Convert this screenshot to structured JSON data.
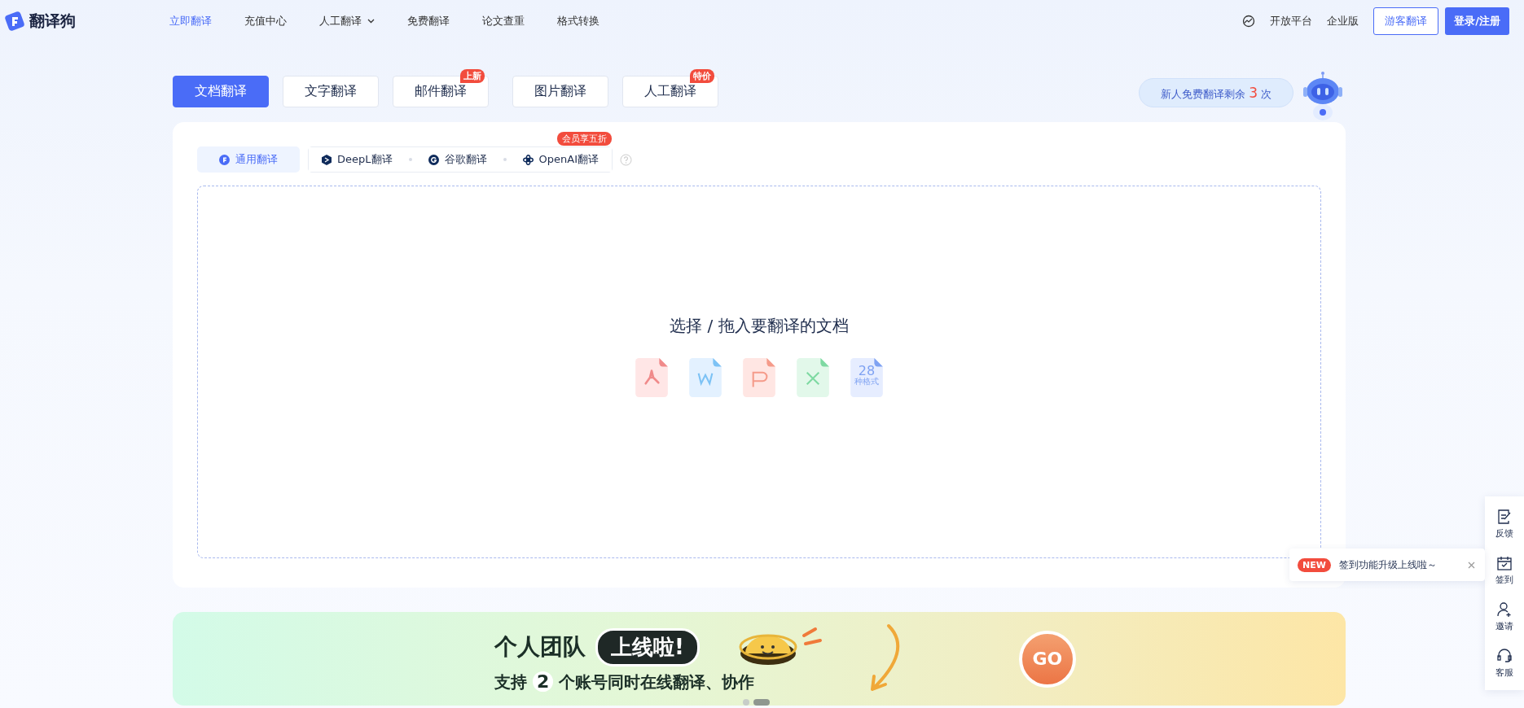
{
  "logo": {
    "text": "翻译狗"
  },
  "nav": {
    "items": [
      {
        "label": "立即翻译",
        "selected": true,
        "kind": "link"
      },
      {
        "label": "充值中心",
        "selected": false,
        "kind": "link"
      },
      {
        "label": "人工翻译",
        "selected": false,
        "kind": "dropdown"
      },
      {
        "label": "免费翻译",
        "selected": false,
        "kind": "link"
      },
      {
        "label": "论文查重",
        "selected": false,
        "kind": "link"
      },
      {
        "label": "格式转换",
        "selected": false,
        "kind": "link"
      }
    ],
    "right_links": [
      "开放平台",
      "企业版"
    ],
    "guest_button": "游客翻译",
    "login_button": "登录/注册"
  },
  "tabs": [
    {
      "label": "文档翻译",
      "selected": true
    },
    {
      "label": "文字翻译",
      "selected": false
    },
    {
      "label": "邮件翻译",
      "selected": false,
      "badge": "上新"
    },
    {
      "label": "图片翻译",
      "selected": false
    },
    {
      "label": "人工翻译",
      "selected": false,
      "badge": "特价"
    }
  ],
  "free_quota": {
    "prefix": "新人免费翻译剩余",
    "count": "3",
    "suffix": "次"
  },
  "engines": [
    {
      "label": "通用翻译",
      "selected": true,
      "kind": "general"
    },
    {
      "label": "DeepL翻译",
      "selected": false,
      "kind": "deepl"
    },
    {
      "label": "谷歌翻译",
      "selected": false,
      "kind": "google"
    },
    {
      "label": "OpenAI翻译",
      "selected": false,
      "kind": "openai",
      "badge": "会员享五折"
    }
  ],
  "dropzone": {
    "title": "选择 / 拖入要翻译的文档",
    "formats": [
      {
        "kind": "pdf"
      },
      {
        "kind": "word"
      },
      {
        "kind": "ppt"
      },
      {
        "kind": "excel"
      },
      {
        "kind": "more",
        "count": "28",
        "caption": "种格式"
      }
    ]
  },
  "banner": {
    "headline": "个人团队",
    "tag": "上线啦!",
    "sub_prefix": "支持",
    "sub_number": "2",
    "sub_suffix": "个账号同时在线翻译、协作",
    "go_button": "GO",
    "slides": [
      {
        "selected": false
      },
      {
        "selected": true
      }
    ]
  },
  "side_tools": [
    {
      "label": "反馈",
      "kind": "feedback"
    },
    {
      "label": "签到",
      "kind": "checkin"
    },
    {
      "label": "邀请",
      "kind": "invite"
    },
    {
      "label": "客服",
      "kind": "service"
    }
  ],
  "toast": {
    "badge": "NEW",
    "text": "签到功能升级上线啦～"
  }
}
